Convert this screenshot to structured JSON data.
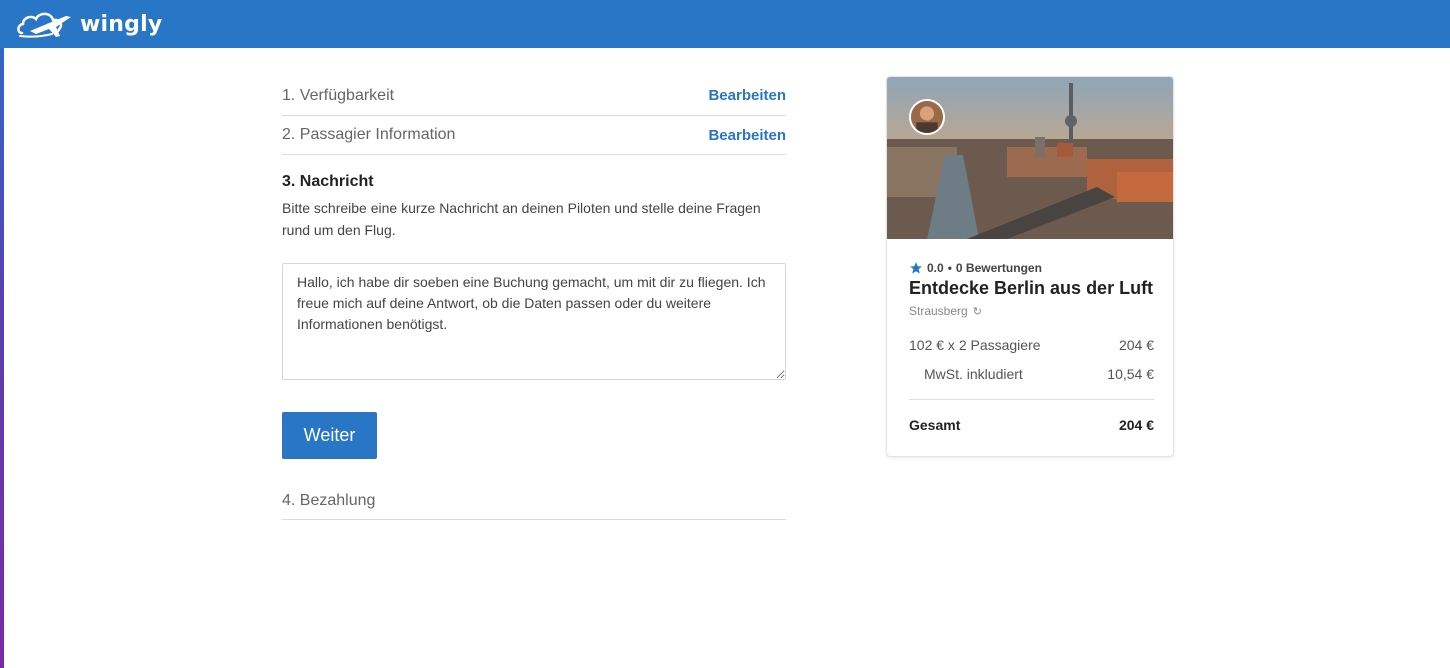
{
  "header": {
    "logo_text": "wingly",
    "bg_color": "#2a76c6"
  },
  "steps": {
    "availability": {
      "title": "1. Verfügbarkeit",
      "edit_label": "Bearbeiten"
    },
    "passenger": {
      "title": "2. Passagier Information",
      "edit_label": "Bearbeiten"
    },
    "message": {
      "title": "3. Nachricht",
      "description": "Bitte schreibe eine kurze Nachricht an deinen Piloten und stelle deine Fragen rund um den Flug.",
      "text_value": "Hallo, ich habe dir soeben eine Buchung gemacht, um mit dir zu fliegen. Ich freue mich auf deine Antwort, ob die Daten passen oder du weitere Informationen benötigst.",
      "next_label": "Weiter"
    },
    "payment": {
      "title": "4. Bezahlung"
    }
  },
  "flight_card": {
    "rating": "0.0",
    "reviews": "0 Bewertungen",
    "title": "Entdecke Berlin aus der Luft",
    "location": "Strausberg",
    "price_label": "102 € x 2 Passagiere",
    "price_value": "204 €",
    "vat_label": "MwSt. inkludiert",
    "vat_value": "10,54 €",
    "total_label": "Gesamt",
    "total_value": "204 €"
  },
  "icons": {
    "logo": "airplane-cloud-icon",
    "star": "star-icon",
    "refresh": "refresh-icon",
    "avatar": "pilot-avatar"
  }
}
